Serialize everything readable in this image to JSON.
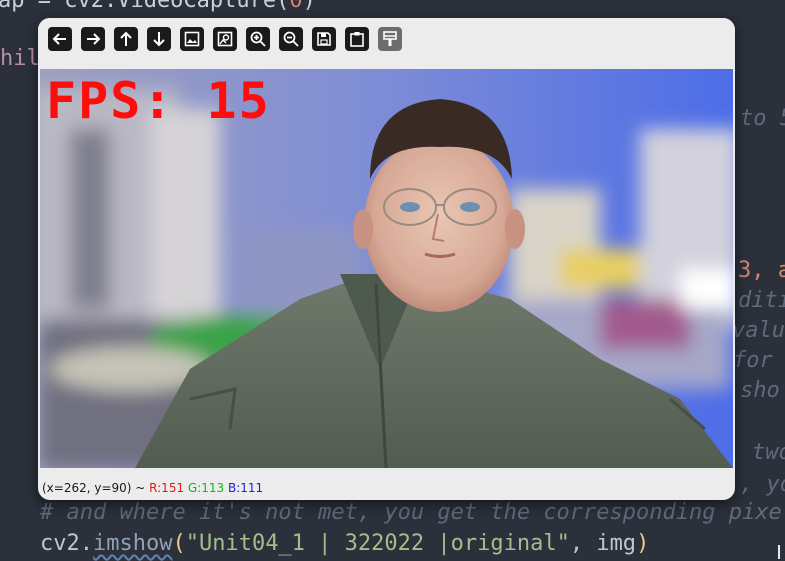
{
  "editor": {
    "line0_pre": "ap = cv2.VideoCapture(",
    "line0_num": "0",
    "line0_post": ")",
    "line1": "hil",
    "side_lines": [
      "to 5",
      "3, a",
      "diti",
      "value",
      "for w",
      "sho",
      "two",
      ", yo"
    ],
    "comment_line": "# and where it's not met, you get the corresponding pixe",
    "last_line": {
      "module": "cv2.",
      "call": "imshow",
      "open": "(",
      "string": "\"Unit04_1 | 322022 |original\"",
      "args": ", img",
      "close": ")"
    }
  },
  "window": {
    "toolbar": [
      {
        "name": "pan-left-button",
        "icon": "arrow-left-icon"
      },
      {
        "name": "pan-right-button",
        "icon": "arrow-right-icon"
      },
      {
        "name": "pan-up-button",
        "icon": "arrow-up-icon"
      },
      {
        "name": "pan-down-button",
        "icon": "arrow-down-icon"
      },
      {
        "name": "zoom-actual-button",
        "icon": "image-icon"
      },
      {
        "name": "zoom-fit-button",
        "icon": "image-search-icon"
      },
      {
        "name": "zoom-in-button",
        "icon": "zoom-in-icon"
      },
      {
        "name": "zoom-out-button",
        "icon": "zoom-out-icon"
      },
      {
        "name": "save-image-button",
        "icon": "save-icon"
      },
      {
        "name": "copy-clipboard-button",
        "icon": "clipboard-icon"
      },
      {
        "name": "properties-button",
        "icon": "paint-brush-icon"
      }
    ],
    "overlay_text": "FPS: 15",
    "status": {
      "coords": "(x=262, y=90) ~ ",
      "r": "R:151",
      "g": "G:113",
      "b": "B:111"
    }
  }
}
